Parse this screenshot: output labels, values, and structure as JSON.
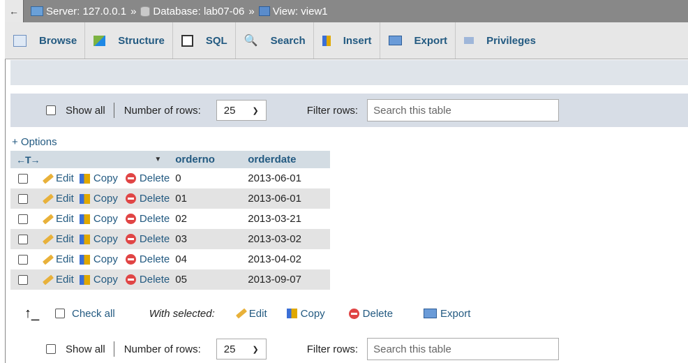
{
  "breadcrumb": {
    "back": "←",
    "server": "Server: 127.0.0.1",
    "database": "Database: lab07-06",
    "view": "View: view1",
    "separator": "»"
  },
  "tabs": [
    {
      "label": "Browse",
      "icon": "browse-icon"
    },
    {
      "label": "Structure",
      "icon": "structure-icon"
    },
    {
      "label": "SQL",
      "icon": "sql-icon"
    },
    {
      "label": "Search",
      "icon": "search-icon"
    },
    {
      "label": "Insert",
      "icon": "insert-icon"
    },
    {
      "label": "Export",
      "icon": "export-icon"
    },
    {
      "label": "Privileges",
      "icon": "privileges-icon"
    }
  ],
  "filter_top": {
    "show_all": "Show all",
    "num_rows_label": "Number of rows:",
    "num_rows_value": "25",
    "filter_label": "Filter rows:",
    "filter_placeholder": "Search this table"
  },
  "options_link": "+ Options",
  "table": {
    "headers": {
      "arrows": "←T→",
      "orderno": "orderno",
      "orderdate": "orderdate"
    },
    "action_labels": {
      "edit": "Edit",
      "copy": "Copy",
      "delete": "Delete"
    },
    "rows": [
      {
        "orderno": "0",
        "orderdate": "2013-06-01"
      },
      {
        "orderno": "01",
        "orderdate": "2013-06-01"
      },
      {
        "orderno": "02",
        "orderdate": "2013-03-21"
      },
      {
        "orderno": "03",
        "orderdate": "2013-03-02"
      },
      {
        "orderno": "04",
        "orderdate": "2013-04-02"
      },
      {
        "orderno": "05",
        "orderdate": "2013-09-07"
      }
    ]
  },
  "bulk": {
    "check_all": "Check all",
    "with_selected": "With selected:",
    "edit": "Edit",
    "copy": "Copy",
    "delete": "Delete",
    "export": "Export"
  },
  "filter_bottom": {
    "show_all": "Show all",
    "num_rows_label": "Number of rows:",
    "num_rows_value": "25",
    "filter_label": "Filter rows:",
    "filter_placeholder": "Search this table"
  },
  "colors": {
    "link": "#235a81",
    "header_bg": "#d3dce3",
    "even_row": "#e3e3e3"
  }
}
